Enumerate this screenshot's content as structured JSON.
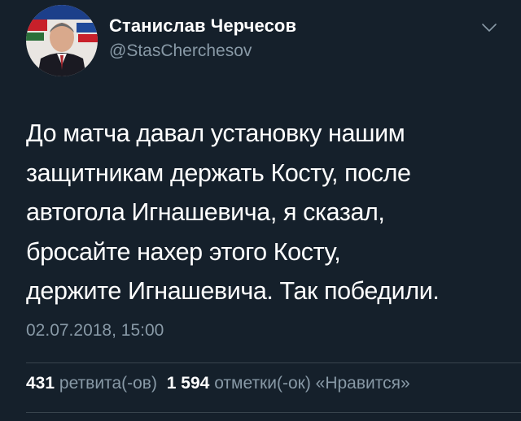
{
  "user": {
    "display_name": "Станислав Черчесов",
    "handle": "@StasCherchesov"
  },
  "tweet": {
    "lines": [
      "До матча давал установку нашим",
      "защитникам держать Косту, после",
      "автогола Игнашевича, я сказал,",
      "бросайте нахер этого Косту,",
      "держите Игнашевича. Так победили."
    ],
    "timestamp": "02.07.2018, 15:00"
  },
  "stats": {
    "retweets_count": "431",
    "retweets_label": "ретвита(-ов)",
    "likes_count": "1 594",
    "likes_label": "отметки(-ок) «Нравится»"
  },
  "icons": {
    "caret": "chevron-down-icon"
  },
  "colors": {
    "background": "#15202b",
    "text": "#ffffff",
    "secondary": "#8899a6",
    "divider": "#38444d"
  }
}
